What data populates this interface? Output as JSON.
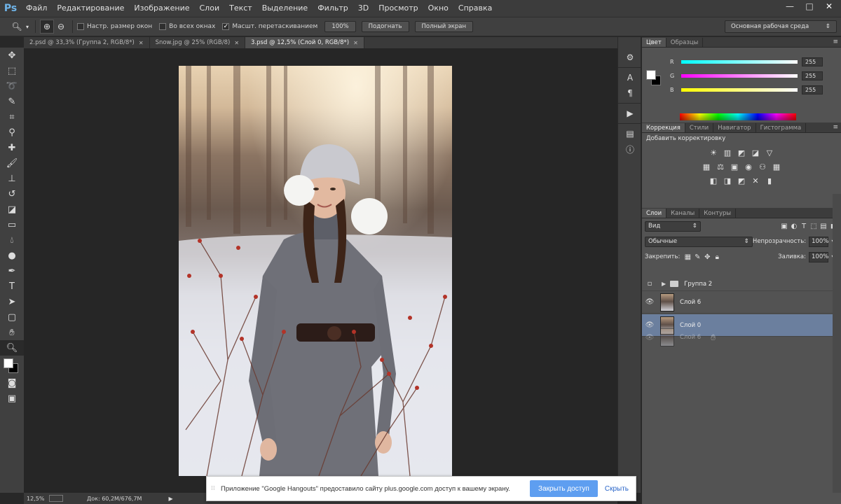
{
  "app": {
    "logo": "Ps"
  },
  "menu": [
    "Файл",
    "Редактирование",
    "Изображение",
    "Слои",
    "Текст",
    "Выделение",
    "Фильтр",
    "3D",
    "Просмотр",
    "Окно",
    "Справка"
  ],
  "window_controls": {
    "minimize": "—",
    "maximize": "□",
    "close": "✕"
  },
  "options": {
    "resize_windows": "Настр. размер окон",
    "all_windows": "Во всех окнах",
    "scrubby_zoom": "Масшт. перетаскиванием",
    "btn_100": "100%",
    "btn_fit": "Подогнать",
    "btn_fill": "Полный экран",
    "workspace": "Основная рабочая среда"
  },
  "doc_tabs": [
    {
      "label": "2.psd @ 33,3% (Группа 2, RGB/8*)",
      "active": false
    },
    {
      "label": "Snow.jpg @ 25% (RGB/8)",
      "active": false
    },
    {
      "label": "3.psd @ 12,5% (Слой 0, RGB/8*)",
      "active": true
    }
  ],
  "status": {
    "zoom": "12,5%",
    "doc": "Док: 60,2M/676,7M"
  },
  "color_panel": {
    "tabs": [
      "Цвет",
      "Образцы"
    ],
    "r_label": "R",
    "g_label": "G",
    "b_label": "B",
    "r_value": "255",
    "g_value": "255",
    "b_value": "255"
  },
  "adjust_panel": {
    "tabs": [
      "Коррекция",
      "Стили",
      "Навигатор",
      "Гистограмма"
    ],
    "title": "Добавить корректировку"
  },
  "layers_panel": {
    "tabs": [
      "Слои",
      "Каналы",
      "Контуры"
    ],
    "filter": "Вид",
    "blend_mode": "Обычные",
    "opacity_label": "Непрозрачность:",
    "opacity_value": "100%",
    "lock_label": "Закрепить:",
    "fill_label": "Заливка:",
    "fill_value": "100%",
    "layers": [
      {
        "name": "Группа 2",
        "type": "group"
      },
      {
        "name": "Слой 6",
        "type": "layer"
      },
      {
        "name": "Слой 0",
        "type": "layer",
        "selected": true
      }
    ],
    "drag_ghost": "Слой 6"
  },
  "notification": {
    "message": "Приложение \"Google Hangouts\" предоставило сайту plus.google.com доступ к вашему экрану.",
    "stop_button": "Закрыть доступ",
    "hide_link": "Скрыть"
  },
  "colors": {
    "accent": "#5e9ef0",
    "selected_layer": "#6b7f9e",
    "panel": "#535353"
  }
}
